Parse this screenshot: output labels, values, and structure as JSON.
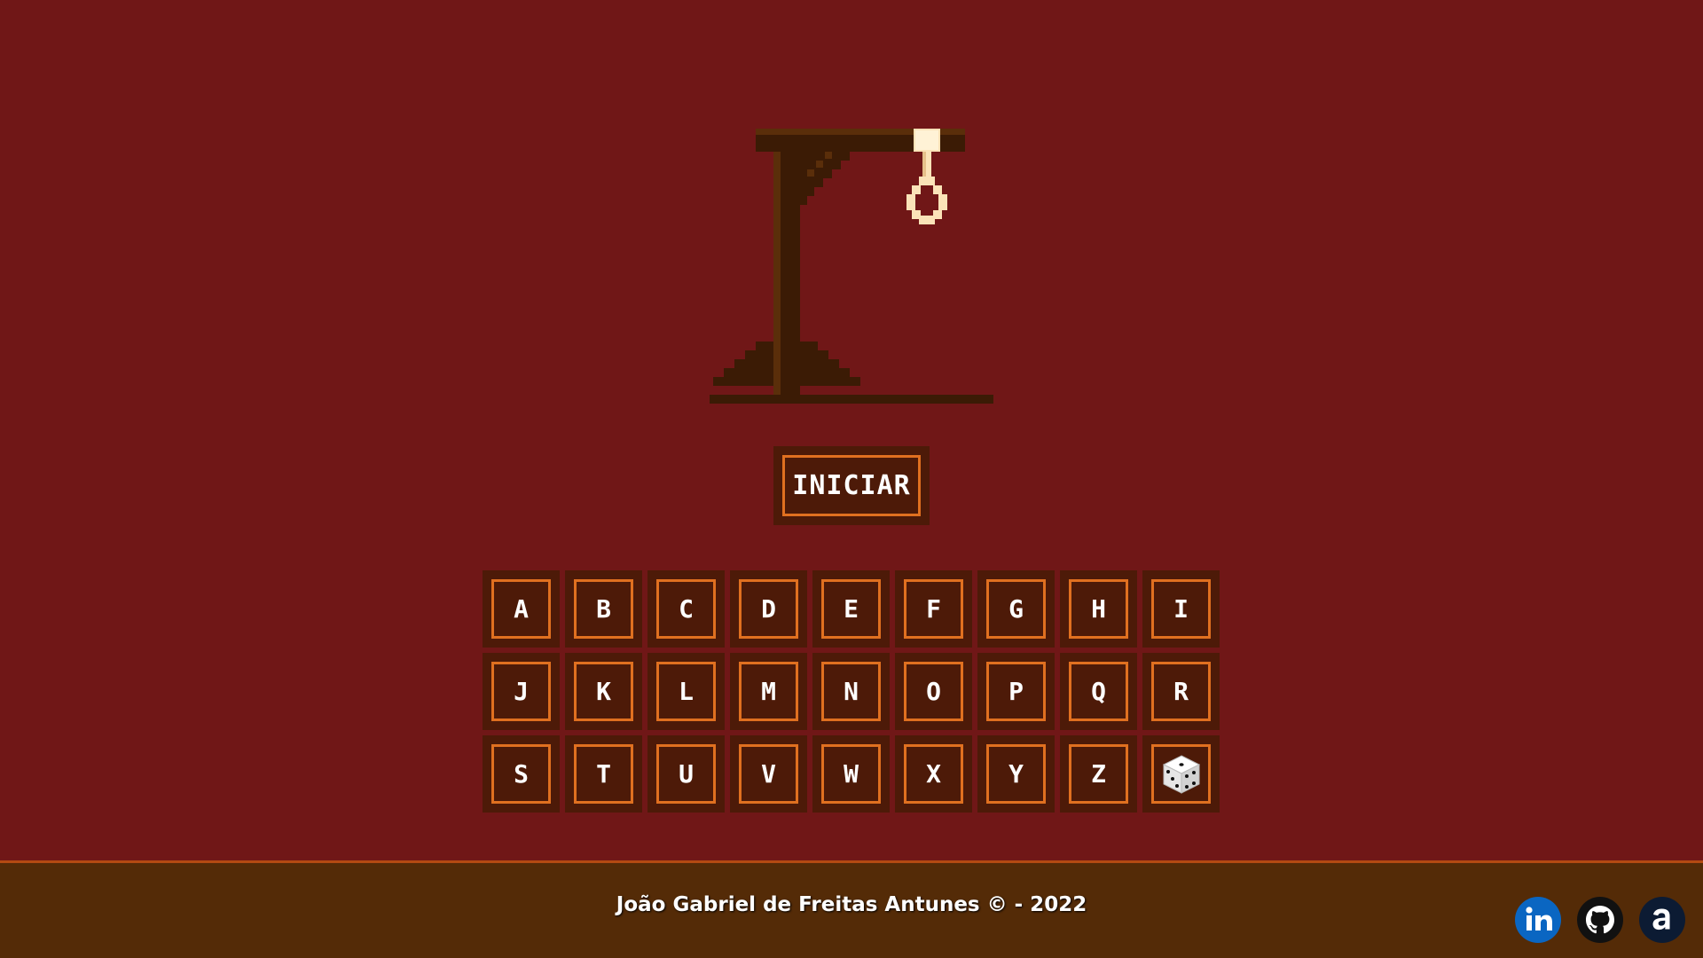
{
  "game": {
    "start_label": "INICIAR"
  },
  "keyboard": {
    "keys": [
      "A",
      "B",
      "C",
      "D",
      "E",
      "F",
      "G",
      "H",
      "I",
      "J",
      "K",
      "L",
      "M",
      "N",
      "O",
      "P",
      "Q",
      "R",
      "S",
      "T",
      "U",
      "V",
      "W",
      "X",
      "Y",
      "Z"
    ],
    "random_key_icon": "dice-icon"
  },
  "footer": {
    "credit": "João Gabriel de Freitas Antunes © - 2022",
    "social_icons": [
      "linkedin-icon",
      "github-icon",
      "amazon-icon"
    ]
  },
  "colors": {
    "background": "#701717",
    "panel": "#4d1a08",
    "accent": "#e07020",
    "footer": "#542b07",
    "linkedin": "#0a66c2",
    "github": "#111111",
    "amazon": "#0c1b33"
  }
}
